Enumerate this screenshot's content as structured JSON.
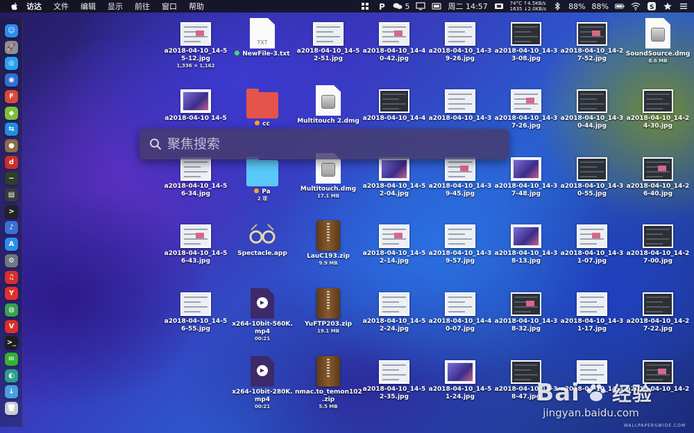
{
  "menubar": {
    "app_name": "访达",
    "menus": [
      "文件",
      "编辑",
      "显示",
      "前往",
      "窗口",
      "帮助"
    ],
    "wechat_badge": "5",
    "clock": "周二 14:57",
    "sensor_top": "74°C ↑4.5KB/s",
    "sensor_bottom": "1635 ↓2.0KB/s",
    "battery1": "88%",
    "battery2": "88%"
  },
  "spotlight": {
    "placeholder": "聚焦搜索"
  },
  "desktop": {
    "rows": [
      [
        {
          "kind": "shot",
          "label": "a2018-04-10_14-5",
          "label2": "5-12.jpg",
          "sub": "1,336 × 1,162"
        },
        {
          "kind": "txt",
          "label": "NewFile-3.txt",
          "icon_text": "TXT",
          "tag": "#4cd964"
        },
        {
          "kind": "shot",
          "label": "a2018-04-10_14-5",
          "label2": "2-51.jpg"
        },
        {
          "kind": "shot",
          "label": "a2018-04-10_14-4",
          "label2": "0-42.jpg"
        },
        {
          "kind": "shot",
          "label": "a2018-04-10_14-3",
          "label2": "9-26.jpg"
        },
        {
          "kind": "shotdark",
          "label": "a2018-04-10_14-3",
          "label2": "3-08.jpg"
        },
        {
          "kind": "shotdark",
          "label": "a2018-04-10_14-2",
          "label2": "7-52.jpg"
        },
        {
          "kind": "dmg",
          "label": "SoundSource.dmg",
          "sub": "8.6 MB"
        }
      ],
      [
        {
          "kind": "shotphoto",
          "label": "a2018-04-10 14-5"
        },
        {
          "kind": "folder",
          "label": "cc",
          "tag": "#f5a623",
          "color": "#e5534b"
        },
        {
          "kind": "dmg",
          "label": "Multitouch 2.dmg"
        },
        {
          "kind": "shotdark",
          "label": "a2018-04-10_14-4"
        },
        {
          "kind": "shot",
          "label": "a2018-04-10_14-3"
        },
        {
          "kind": "shot",
          "label": "a2018-04-10_14-3",
          "label2": "7-26.jpg"
        },
        {
          "kind": "shotdark",
          "label": "a2018-04-10_14-3",
          "label2": "0-44.jpg"
        },
        {
          "kind": "shotdark",
          "label": "a2018-04-10_14-2",
          "label2": "4-30.jpg"
        }
      ],
      [
        {
          "kind": "shot",
          "label": "a2018-04-10_14-5",
          "label2": "6-34.jpg"
        },
        {
          "kind": "folder",
          "label": "Pa",
          "tag": "#f5a623",
          "color": "#5ac8fa",
          "sub": "2 项"
        },
        {
          "kind": "dmg",
          "label": "Multitouch.dmg",
          "sub": "17.1 MB"
        },
        {
          "kind": "shotphoto",
          "label": "a2018-04-10_14-5",
          "label2": "2-04.jpg"
        },
        {
          "kind": "shot",
          "label": "a2018-04-10_14-3",
          "label2": "9-45.jpg"
        },
        {
          "kind": "shotphoto",
          "label": "a2018-04-10_14-3",
          "label2": "7-48.jpg"
        },
        {
          "kind": "shotdark",
          "label": "a2018-04-10_14-3",
          "label2": "0-55.jpg"
        },
        {
          "kind": "shotdark",
          "label": "a2018-04-10_14-2",
          "label2": "6-40.jpg"
        }
      ],
      [
        {
          "kind": "shot",
          "label": "a2018-04-10_14-5",
          "label2": "6-43.jpg"
        },
        {
          "kind": "app",
          "label": "Spectacle.app"
        },
        {
          "kind": "zip",
          "label": "LauC193.zip",
          "sub": "9.9 MB"
        },
        {
          "kind": "shot",
          "label": "a2018-04-10_14-5",
          "label2": "2-14.jpg"
        },
        {
          "kind": "shot",
          "label": "a2018-04-10_14-3",
          "label2": "9-57.jpg"
        },
        {
          "kind": "shotphoto",
          "label": "a2018-04-10_14-3",
          "label2": "8-13.jpg"
        },
        {
          "kind": "shot",
          "label": "a2018-04-10_14-3",
          "label2": "1-07.jpg"
        },
        {
          "kind": "shotdark",
          "label": "a2018-04-10_14-2",
          "label2": "7-00.jpg"
        }
      ],
      [
        {
          "kind": "shot",
          "label": "a2018-04-10_14-5",
          "label2": "6-55.jpg"
        },
        {
          "kind": "mp4",
          "label": "x264-10bit-560K.",
          "label2": "mp4",
          "sub": "00:21"
        },
        {
          "kind": "zip",
          "label": "YuFTP203.zip",
          "sub": "19.1 MB"
        },
        {
          "kind": "shot",
          "label": "a2018-04-10_14-5",
          "label2": "2-24.jpg"
        },
        {
          "kind": "shot",
          "label": "a2018-04-10_14-4",
          "label2": "0-07.jpg"
        },
        {
          "kind": "shotdark",
          "label": "a2018-04-10_14-3",
          "label2": "8-32.jpg"
        },
        {
          "kind": "shot",
          "label": "a2018-04-10_14-3",
          "label2": "1-17.jpg"
        },
        {
          "kind": "shotdark",
          "label": "a2018-04-10_14-2",
          "label2": "7-22.jpg"
        }
      ],
      [
        {
          "kind": "none"
        },
        {
          "kind": "mp4",
          "label": "x264-10bit-280K.",
          "label2": "mp4",
          "sub": "00:21"
        },
        {
          "kind": "zip",
          "label": "nmac.to_temon102",
          "label2": ".zip",
          "sub": "5.5 MB"
        },
        {
          "kind": "shot",
          "label": "a2018-04-10_14-5",
          "label2": "2-35.jpg"
        },
        {
          "kind": "shotphoto",
          "label": "a2018-04-10_14-5",
          "label2": "1-24.jpg"
        },
        {
          "kind": "shotdark",
          "label": "a2018-04-10_14-3",
          "label2": "8-47.jpg"
        },
        {
          "kind": "shot",
          "label": "a2018-04-10_14-3"
        },
        {
          "kind": "shotdark",
          "label": "a2018-04-10_14-2"
        }
      ]
    ]
  },
  "dock": [
    {
      "name": "finder",
      "color": "#2a8cf0",
      "glyph": "☺"
    },
    {
      "name": "launchpad",
      "color": "#8a8f99",
      "glyph": "🚀"
    },
    {
      "name": "safari",
      "color": "#2aa0f0",
      "glyph": "◎"
    },
    {
      "name": "preview",
      "color": "#2f6fd6",
      "glyph": "◉"
    },
    {
      "name": "app-red",
      "color": "#d64a3a",
      "glyph": "F"
    },
    {
      "name": "android",
      "color": "#7cbf3a",
      "glyph": "◆"
    },
    {
      "name": "teamviewer",
      "color": "#1e8ee0",
      "glyph": "⇆"
    },
    {
      "name": "app-round",
      "color": "#8a6a4a",
      "glyph": "●"
    },
    {
      "name": "app-red2",
      "color": "#c8302a",
      "glyph": "d"
    },
    {
      "name": "activity",
      "color": "#2c3e2c",
      "glyph": "~"
    },
    {
      "name": "console",
      "color": "#3a3a3a",
      "glyph": "▤"
    },
    {
      "name": "terminal",
      "color": "#222",
      "glyph": ">"
    },
    {
      "name": "siri",
      "color": "#3a6fd6",
      "glyph": "♪"
    },
    {
      "name": "app-store",
      "color": "#2a8ef0",
      "glyph": "A"
    },
    {
      "name": "preferences",
      "color": "#707780",
      "glyph": "⚙"
    },
    {
      "name": "netease-music",
      "color": "#d6302a",
      "glyph": "♫"
    },
    {
      "name": "yandex",
      "color": "#e0302a",
      "glyph": "Y"
    },
    {
      "name": "chrome",
      "color": "#3aa050",
      "glyph": "◍"
    },
    {
      "name": "vivaldi",
      "color": "#d8302a",
      "glyph": "V"
    },
    {
      "name": "terminal2",
      "color": "#1e1e1e",
      "glyph": ">_"
    },
    {
      "name": "wechat",
      "color": "#33b030",
      "glyph": "✉"
    },
    {
      "name": "app-teal",
      "color": "#2aa08a",
      "glyph": "◐"
    },
    {
      "name": "downloads",
      "color": "#4a9fe0",
      "glyph": "↓"
    },
    {
      "name": "trash",
      "color": "#c8ccd2",
      "glyph": "🗑"
    }
  ],
  "watermark": {
    "brand": "Bai",
    "brand_cn": "经验",
    "site": "jingyan.baidu.com",
    "wallpaper_site": "WALLPAPERSWIDE.COM"
  },
  "colors": {
    "menubar_bg": "#14141e",
    "spotlight_bg": "#463c6e"
  }
}
